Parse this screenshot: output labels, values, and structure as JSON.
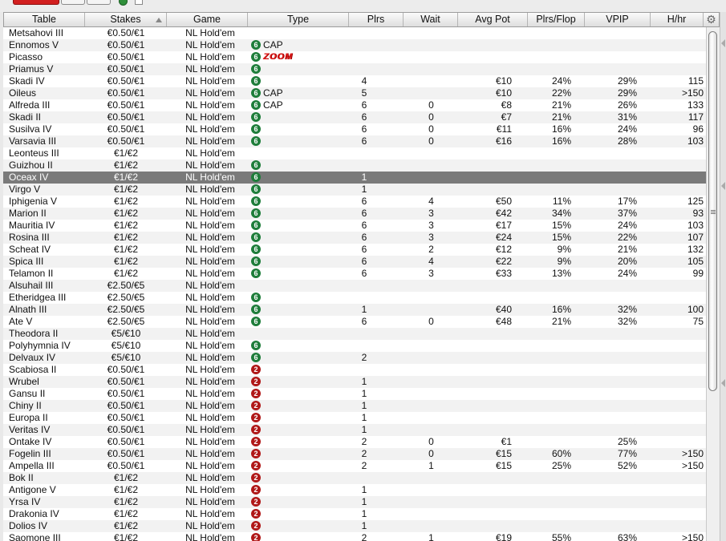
{
  "columns": [
    "Table",
    "Stakes",
    "Game",
    "Type",
    "Plrs",
    "Wait",
    "Avg Pot",
    "Plrs/Flop",
    "VPIP",
    "H/hr"
  ],
  "icons": {
    "sort": "sort-up-icon",
    "settings": "gear-icon",
    "six_max": "6",
    "heads_up": "2"
  },
  "colors": {
    "six_max_badge": "#1e7d3a",
    "heads_up_badge": "#b01818",
    "zoom": "#e01b1b",
    "selected_row": "#7a7a7a"
  },
  "rows": [
    {
      "table": "Metsahovi III",
      "stakes": "€0.50/€1",
      "game": "NL Hold'em",
      "badge": "",
      "type": "",
      "plrs": "",
      "wait": "",
      "pot": "",
      "flop": "",
      "vpip": "",
      "hhr": ""
    },
    {
      "table": "Ennomos V",
      "stakes": "€0.50/€1",
      "game": "NL Hold'em",
      "badge": "6",
      "type": "CAP",
      "plrs": "",
      "wait": "",
      "pot": "",
      "flop": "",
      "vpip": "",
      "hhr": ""
    },
    {
      "table": "Picasso",
      "stakes": "€0.50/€1",
      "game": "NL Hold'em",
      "badge": "6",
      "type": "ZOOM",
      "plrs": "",
      "wait": "",
      "pot": "",
      "flop": "",
      "vpip": "",
      "hhr": ""
    },
    {
      "table": "Priamus V",
      "stakes": "€0.50/€1",
      "game": "NL Hold'em",
      "badge": "6",
      "type": "",
      "plrs": "",
      "wait": "",
      "pot": "",
      "flop": "",
      "vpip": "",
      "hhr": ""
    },
    {
      "table": "Skadi IV",
      "stakes": "€0.50/€1",
      "game": "NL Hold'em",
      "badge": "6",
      "type": "",
      "plrs": "4",
      "wait": "",
      "pot": "€10",
      "flop": "24%",
      "vpip": "29%",
      "hhr": "115"
    },
    {
      "table": "Oileus",
      "stakes": "€0.50/€1",
      "game": "NL Hold'em",
      "badge": "6",
      "type": "CAP",
      "plrs": "5",
      "wait": "",
      "pot": "€10",
      "flop": "22%",
      "vpip": "29%",
      "hhr": ">150"
    },
    {
      "table": "Alfreda III",
      "stakes": "€0.50/€1",
      "game": "NL Hold'em",
      "badge": "6",
      "type": "CAP",
      "plrs": "6",
      "wait": "0",
      "pot": "€8",
      "flop": "21%",
      "vpip": "26%",
      "hhr": "133"
    },
    {
      "table": "Skadi II",
      "stakes": "€0.50/€1",
      "game": "NL Hold'em",
      "badge": "6",
      "type": "",
      "plrs": "6",
      "wait": "0",
      "pot": "€7",
      "flop": "21%",
      "vpip": "31%",
      "hhr": "117"
    },
    {
      "table": "Susilva IV",
      "stakes": "€0.50/€1",
      "game": "NL Hold'em",
      "badge": "6",
      "type": "",
      "plrs": "6",
      "wait": "0",
      "pot": "€11",
      "flop": "16%",
      "vpip": "24%",
      "hhr": "96"
    },
    {
      "table": "Varsavia III",
      "stakes": "€0.50/€1",
      "game": "NL Hold'em",
      "badge": "6",
      "type": "",
      "plrs": "6",
      "wait": "0",
      "pot": "€16",
      "flop": "16%",
      "vpip": "28%",
      "hhr": "103"
    },
    {
      "table": "Leonteus III",
      "stakes": "€1/€2",
      "game": "NL Hold'em",
      "badge": "",
      "type": "",
      "plrs": "",
      "wait": "",
      "pot": "",
      "flop": "",
      "vpip": "",
      "hhr": ""
    },
    {
      "table": "Guizhou II",
      "stakes": "€1/€2",
      "game": "NL Hold'em",
      "badge": "6",
      "type": "",
      "plrs": "",
      "wait": "",
      "pot": "",
      "flop": "",
      "vpip": "",
      "hhr": ""
    },
    {
      "table": "Oceax IV",
      "stakes": "€1/€2",
      "game": "NL Hold'em",
      "badge": "6",
      "type": "",
      "plrs": "1",
      "wait": "",
      "pot": "",
      "flop": "",
      "vpip": "",
      "hhr": "",
      "selected": true
    },
    {
      "table": "Virgo V",
      "stakes": "€1/€2",
      "game": "NL Hold'em",
      "badge": "6",
      "type": "",
      "plrs": "1",
      "wait": "",
      "pot": "",
      "flop": "",
      "vpip": "",
      "hhr": ""
    },
    {
      "table": "Iphigenia V",
      "stakes": "€1/€2",
      "game": "NL Hold'em",
      "badge": "6",
      "type": "",
      "plrs": "6",
      "wait": "4",
      "pot": "€50",
      "flop": "11%",
      "vpip": "17%",
      "hhr": "125"
    },
    {
      "table": "Marion II",
      "stakes": "€1/€2",
      "game": "NL Hold'em",
      "badge": "6",
      "type": "",
      "plrs": "6",
      "wait": "3",
      "pot": "€42",
      "flop": "34%",
      "vpip": "37%",
      "hhr": "93"
    },
    {
      "table": "Mauritia IV",
      "stakes": "€1/€2",
      "game": "NL Hold'em",
      "badge": "6",
      "type": "",
      "plrs": "6",
      "wait": "3",
      "pot": "€17",
      "flop": "15%",
      "vpip": "24%",
      "hhr": "103"
    },
    {
      "table": "Rosina III",
      "stakes": "€1/€2",
      "game": "NL Hold'em",
      "badge": "6",
      "type": "",
      "plrs": "6",
      "wait": "3",
      "pot": "€24",
      "flop": "15%",
      "vpip": "22%",
      "hhr": "107"
    },
    {
      "table": "Scheat IV",
      "stakes": "€1/€2",
      "game": "NL Hold'em",
      "badge": "6",
      "type": "",
      "plrs": "6",
      "wait": "2",
      "pot": "€12",
      "flop": "9%",
      "vpip": "21%",
      "hhr": "132"
    },
    {
      "table": "Spica III",
      "stakes": "€1/€2",
      "game": "NL Hold'em",
      "badge": "6",
      "type": "",
      "plrs": "6",
      "wait": "4",
      "pot": "€22",
      "flop": "9%",
      "vpip": "20%",
      "hhr": "105"
    },
    {
      "table": "Telamon II",
      "stakes": "€1/€2",
      "game": "NL Hold'em",
      "badge": "6",
      "type": "",
      "plrs": "6",
      "wait": "3",
      "pot": "€33",
      "flop": "13%",
      "vpip": "24%",
      "hhr": "99"
    },
    {
      "table": "Alsuhail III",
      "stakes": "€2.50/€5",
      "game": "NL Hold'em",
      "badge": "",
      "type": "",
      "plrs": "",
      "wait": "",
      "pot": "",
      "flop": "",
      "vpip": "",
      "hhr": ""
    },
    {
      "table": "Etheridgea III",
      "stakes": "€2.50/€5",
      "game": "NL Hold'em",
      "badge": "6",
      "type": "",
      "plrs": "",
      "wait": "",
      "pot": "",
      "flop": "",
      "vpip": "",
      "hhr": ""
    },
    {
      "table": "Alnath III",
      "stakes": "€2.50/€5",
      "game": "NL Hold'em",
      "badge": "6",
      "type": "",
      "plrs": "1",
      "wait": "",
      "pot": "€40",
      "flop": "16%",
      "vpip": "32%",
      "hhr": "100"
    },
    {
      "table": "Ate V",
      "stakes": "€2.50/€5",
      "game": "NL Hold'em",
      "badge": "6",
      "type": "",
      "plrs": "6",
      "wait": "0",
      "pot": "€48",
      "flop": "21%",
      "vpip": "32%",
      "hhr": "75"
    },
    {
      "table": "Theodora II",
      "stakes": "€5/€10",
      "game": "NL Hold'em",
      "badge": "",
      "type": "",
      "plrs": "",
      "wait": "",
      "pot": "",
      "flop": "",
      "vpip": "",
      "hhr": ""
    },
    {
      "table": "Polyhymnia IV",
      "stakes": "€5/€10",
      "game": "NL Hold'em",
      "badge": "6",
      "type": "",
      "plrs": "",
      "wait": "",
      "pot": "",
      "flop": "",
      "vpip": "",
      "hhr": ""
    },
    {
      "table": "Delvaux IV",
      "stakes": "€5/€10",
      "game": "NL Hold'em",
      "badge": "6",
      "type": "",
      "plrs": "2",
      "wait": "",
      "pot": "",
      "flop": "",
      "vpip": "",
      "hhr": ""
    },
    {
      "table": "Scabiosa II",
      "stakes": "€0.50/€1",
      "game": "NL Hold'em",
      "badge": "2",
      "type": "",
      "plrs": "",
      "wait": "",
      "pot": "",
      "flop": "",
      "vpip": "",
      "hhr": ""
    },
    {
      "table": "Wrubel",
      "stakes": "€0.50/€1",
      "game": "NL Hold'em",
      "badge": "2",
      "type": "",
      "plrs": "1",
      "wait": "",
      "pot": "",
      "flop": "",
      "vpip": "",
      "hhr": ""
    },
    {
      "table": "Gansu II",
      "stakes": "€0.50/€1",
      "game": "NL Hold'em",
      "badge": "2",
      "type": "",
      "plrs": "1",
      "wait": "",
      "pot": "",
      "flop": "",
      "vpip": "",
      "hhr": ""
    },
    {
      "table": "Chiny II",
      "stakes": "€0.50/€1",
      "game": "NL Hold'em",
      "badge": "2",
      "type": "",
      "plrs": "1",
      "wait": "",
      "pot": "",
      "flop": "",
      "vpip": "",
      "hhr": ""
    },
    {
      "table": "Europa II",
      "stakes": "€0.50/€1",
      "game": "NL Hold'em",
      "badge": "2",
      "type": "",
      "plrs": "1",
      "wait": "",
      "pot": "",
      "flop": "",
      "vpip": "",
      "hhr": ""
    },
    {
      "table": "Veritas IV",
      "stakes": "€0.50/€1",
      "game": "NL Hold'em",
      "badge": "2",
      "type": "",
      "plrs": "1",
      "wait": "",
      "pot": "",
      "flop": "",
      "vpip": "",
      "hhr": ""
    },
    {
      "table": "Ontake IV",
      "stakes": "€0.50/€1",
      "game": "NL Hold'em",
      "badge": "2",
      "type": "",
      "plrs": "2",
      "wait": "0",
      "pot": "€1",
      "flop": "",
      "vpip": "25%",
      "hhr": ""
    },
    {
      "table": "Fogelin III",
      "stakes": "€0.50/€1",
      "game": "NL Hold'em",
      "badge": "2",
      "type": "",
      "plrs": "2",
      "wait": "0",
      "pot": "€15",
      "flop": "60%",
      "vpip": "77%",
      "hhr": ">150"
    },
    {
      "table": "Ampella III",
      "stakes": "€0.50/€1",
      "game": "NL Hold'em",
      "badge": "2",
      "type": "",
      "plrs": "2",
      "wait": "1",
      "pot": "€15",
      "flop": "25%",
      "vpip": "52%",
      "hhr": ">150"
    },
    {
      "table": "Bok II",
      "stakes": "€1/€2",
      "game": "NL Hold'em",
      "badge": "2",
      "type": "",
      "plrs": "",
      "wait": "",
      "pot": "",
      "flop": "",
      "vpip": "",
      "hhr": ""
    },
    {
      "table": "Antigone V",
      "stakes": "€1/€2",
      "game": "NL Hold'em",
      "badge": "2",
      "type": "",
      "plrs": "1",
      "wait": "",
      "pot": "",
      "flop": "",
      "vpip": "",
      "hhr": ""
    },
    {
      "table": "Yrsa IV",
      "stakes": "€1/€2",
      "game": "NL Hold'em",
      "badge": "2",
      "type": "",
      "plrs": "1",
      "wait": "",
      "pot": "",
      "flop": "",
      "vpip": "",
      "hhr": ""
    },
    {
      "table": "Drakonia IV",
      "stakes": "€1/€2",
      "game": "NL Hold'em",
      "badge": "2",
      "type": "",
      "plrs": "1",
      "wait": "",
      "pot": "",
      "flop": "",
      "vpip": "",
      "hhr": ""
    },
    {
      "table": "Dolios IV",
      "stakes": "€1/€2",
      "game": "NL Hold'em",
      "badge": "2",
      "type": "",
      "plrs": "1",
      "wait": "",
      "pot": "",
      "flop": "",
      "vpip": "",
      "hhr": ""
    },
    {
      "table": "Saomone III",
      "stakes": "€1/€2",
      "game": "NL Hold'em",
      "badge": "2",
      "type": "",
      "plrs": "2",
      "wait": "1",
      "pot": "€19",
      "flop": "55%",
      "vpip": "63%",
      "hhr": ">150"
    }
  ]
}
